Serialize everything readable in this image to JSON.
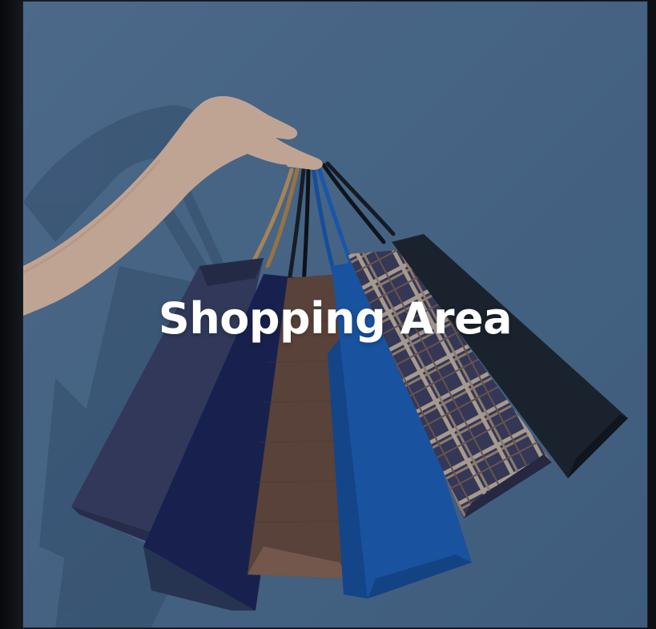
{
  "card": {
    "title": "Shopping Area"
  },
  "colors": {
    "background": "#0b0d11",
    "card_wall": "#4f6f92",
    "title_text": "#ffffff"
  }
}
